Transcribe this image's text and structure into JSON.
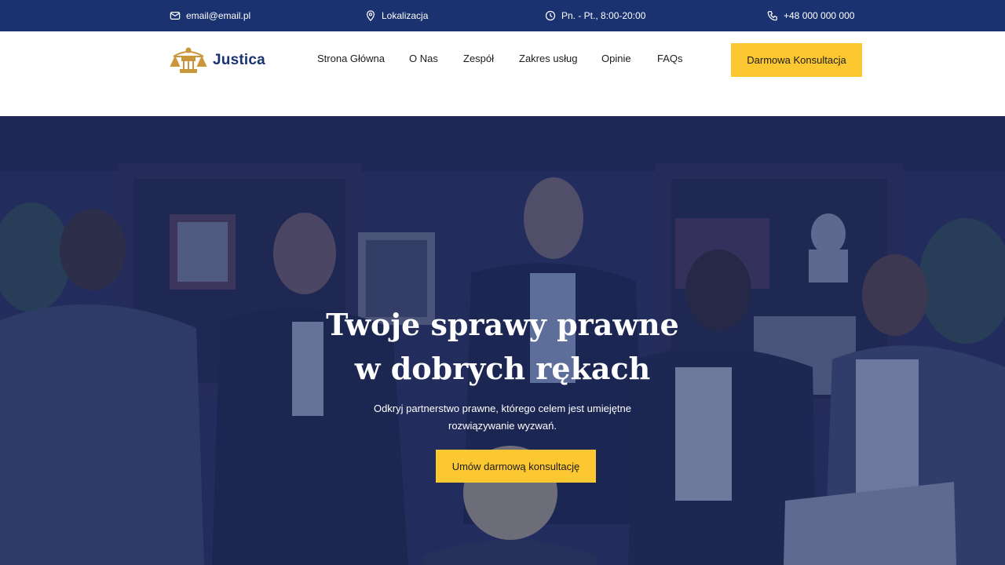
{
  "topbar": {
    "email": "email@email.pl",
    "location": "Lokalizacja",
    "hours": "Pn. - Pt., 8:00-20:00",
    "phone": "+48 000 000 000",
    "icons": [
      "mail-icon",
      "map-pin-icon",
      "clock-icon",
      "phone-icon"
    ]
  },
  "brand": {
    "name": "Justica",
    "logo_color": "#c9963a"
  },
  "nav": {
    "items": [
      {
        "label": "Strona Główna"
      },
      {
        "label": "O Nas"
      },
      {
        "label": "Zespół"
      },
      {
        "label": "Zakres usług"
      },
      {
        "label": "Opinie"
      },
      {
        "label": "FAQs"
      }
    ],
    "cta_label": "Darmowa Konsultacja"
  },
  "hero": {
    "title_line1": "Twoje sprawy prawne",
    "title_line2": "w dobrych rękach",
    "subtitle_line1": "Odkryj partnerstwo prawne, którego celem jest umiejętne",
    "subtitle_line2": "rozwiązywanie wyzwań.",
    "cta_label": "Umów darmową konsultację"
  },
  "colors": {
    "primary": "#1a3270",
    "accent": "#fcc832",
    "text": "#1c1c1c"
  }
}
